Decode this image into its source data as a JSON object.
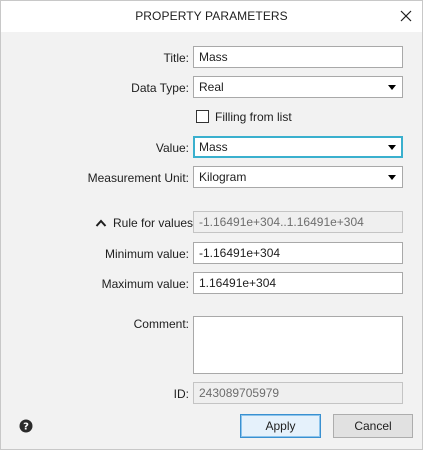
{
  "dialog": {
    "title": "PROPERTY PARAMETERS",
    "close_icon": "close-icon"
  },
  "fields": {
    "title": {
      "label": "Title:",
      "value": "Mass"
    },
    "data_type": {
      "label": "Data Type:",
      "value": "Real"
    },
    "filling_from_list": {
      "label": "Filling from list",
      "checked": false
    },
    "value": {
      "label": "Value:",
      "value": "Mass"
    },
    "measurement_unit": {
      "label": "Measurement Unit:",
      "value": "Kilogram"
    },
    "rule": {
      "label": "Rule for values",
      "value": "-1.16491e+304..1.16491e+304",
      "toggle_icon": "chevron-up-icon"
    },
    "minimum": {
      "label": "Minimum value:",
      "value": "-1.16491e+304"
    },
    "maximum": {
      "label": "Maximum value:",
      "value": "1.16491e+304"
    },
    "comment": {
      "label": "Comment:",
      "value": ""
    },
    "id": {
      "label": "ID:",
      "value": "243089705979"
    }
  },
  "buttons": {
    "apply": "Apply",
    "cancel": "Cancel",
    "help_icon": "help-icon"
  },
  "colors": {
    "focus_border": "#3ab0ce",
    "apply_border": "#3a90d0",
    "dialog_background": "#f2f2f2"
  }
}
